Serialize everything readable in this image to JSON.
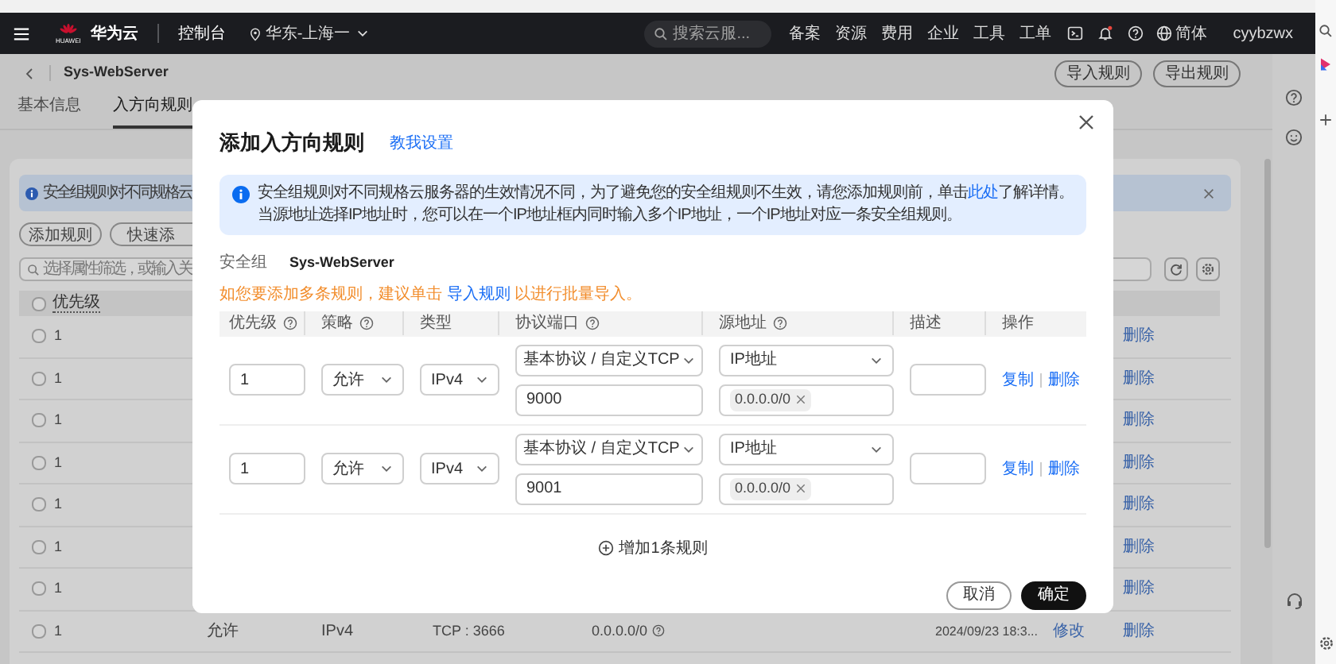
{
  "nav": {
    "logo_text": "HUAWEI",
    "brand": "华为云",
    "console": "控制台",
    "region": "华东-上海一",
    "search": {
      "placeholder": "搜索云服..."
    },
    "links": [
      "备案",
      "资源",
      "费用",
      "企业",
      "工具",
      "工单"
    ],
    "language": "简体",
    "user": "cyybzwx"
  },
  "page": {
    "title": "Sys-WebServer",
    "buttons": [
      "导入规则",
      "导出规则"
    ],
    "tabs": [
      {
        "label": "基本信息",
        "selected": false
      },
      {
        "label": "入方向规则",
        "selected": true
      }
    ],
    "notice": "安全组规则对不同规格云",
    "actions": [
      "添加规则",
      "快速添"
    ],
    "search": {
      "placeholder": "选择属性筛选，或输入关"
    },
    "table": {
      "header": {
        "checked": false,
        "label": "优先级"
      },
      "rows": [
        {
          "checked": false,
          "priority": "1",
          "delete": "删除"
        },
        {
          "checked": false,
          "priority": "1",
          "delete": "删除"
        },
        {
          "checked": false,
          "priority": "1",
          "delete": "删除"
        },
        {
          "checked": false,
          "priority": "1",
          "delete": "删除"
        },
        {
          "checked": false,
          "priority": "1",
          "delete": "删除"
        },
        {
          "checked": false,
          "priority": "1",
          "delete": "删除"
        },
        {
          "checked": false,
          "priority": "1",
          "delete": "删除"
        },
        {
          "checked": false,
          "priority": "1",
          "policy": "允许",
          "type": "IPv4",
          "port": "TCP : 3666",
          "source": "0.0.0.0/0",
          "time": "2024/09/23 18:3...",
          "edit": "修改",
          "delete": "删除"
        }
      ]
    }
  },
  "dialog": {
    "title": "添加入方向规则",
    "help_link": "教我设置",
    "info": {
      "line1_before": "安全组规则对不同规格云服务器的生效情况不同，为了避免您的安全组规则不生效，请您添加规则前，单击",
      "line1_link": "此处",
      "line1_after": "了解详情。",
      "line2": "当源地址选择IP地址时，您可以在一个IP地址框内同时输入多个IP地址，一个IP地址对应一条安全组规则。"
    },
    "security_group": {
      "label": "安全组",
      "value": "Sys-WebServer"
    },
    "tip": {
      "before": "如您要添加多条规则，建议单击 ",
      "link": "导入规则",
      "after": " 以进行批量导入。"
    },
    "columns": [
      {
        "label": "优先级",
        "help": true
      },
      {
        "label": "策略",
        "help": true
      },
      {
        "label": "类型",
        "help": false
      },
      {
        "label": "协议端口",
        "help": true
      },
      {
        "label": "源地址",
        "help": true
      },
      {
        "label": "描述",
        "help": false
      },
      {
        "label": "操作",
        "help": false
      }
    ],
    "rules": [
      {
        "priority": "1",
        "policy": "允许",
        "type": "IPv4",
        "protocol": "基本协议 / 自定义TCP",
        "port": "9000",
        "source_type": "IP地址",
        "sources": [
          "0.0.0.0/0"
        ],
        "actions": [
          "复制",
          "删除"
        ]
      },
      {
        "priority": "1",
        "policy": "允许",
        "type": "IPv4",
        "protocol": "基本协议 / 自定义TCP",
        "port": "9001",
        "source_type": "IP地址",
        "sources": [
          "0.0.0.0/0"
        ],
        "actions": [
          "复制",
          "删除"
        ]
      }
    ],
    "add_rule": "增加1条规则",
    "buttons": [
      {
        "label": "取消",
        "kind": "secondary"
      },
      {
        "label": "确定",
        "kind": "primary"
      }
    ]
  }
}
